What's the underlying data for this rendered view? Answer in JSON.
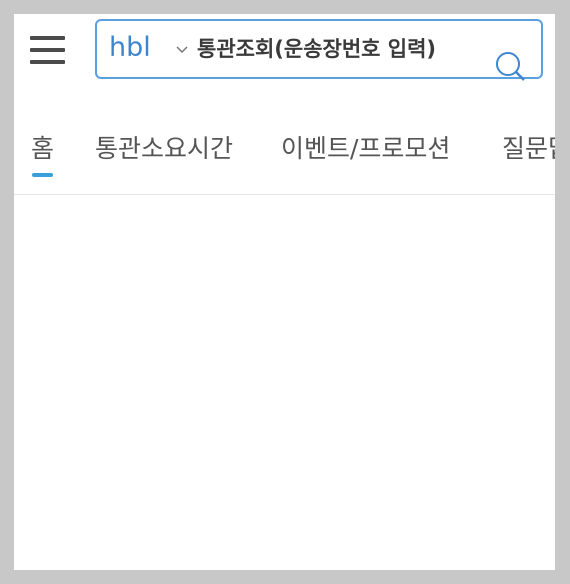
{
  "search": {
    "type_selected": "hbl",
    "placeholder": "통관조회(운송장번호 입력)"
  },
  "tabs": [
    {
      "label": "홈",
      "active": true
    },
    {
      "label": "통관소요시간",
      "active": false
    },
    {
      "label": "이벤트/프로모션",
      "active": false
    },
    {
      "label": "질문답",
      "active": false
    }
  ],
  "colors": {
    "accent": "#3aa0d8",
    "search_border": "#5aa0e0",
    "search_type_text": "#3d86cf"
  },
  "icons": {
    "menu": "hamburger-icon",
    "dropdown": "chevron-down-icon",
    "search": "search-icon"
  }
}
